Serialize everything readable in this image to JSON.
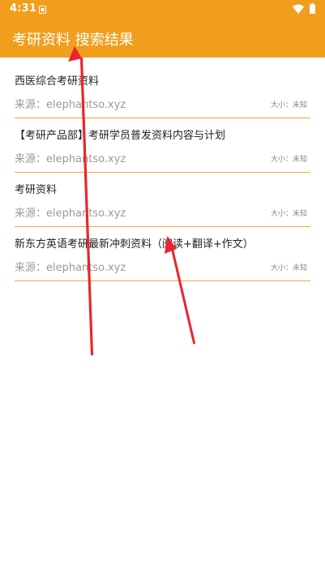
{
  "status_bar": {
    "time": "4:31",
    "icons": [
      "sim-card-icon",
      "wifi-icon",
      "battery-icon"
    ]
  },
  "header": {
    "title": "考研资料 搜索结果"
  },
  "results": [
    {
      "title": "西医综合考研资料",
      "source": "来源：elephantso.xyz",
      "size": "大小：未知"
    },
    {
      "title": "【考研产品部】考研学员普发资料内容与计划",
      "source": "来源：elephantso.xyz",
      "size": "大小：未知"
    },
    {
      "title": "考研资料",
      "source": "来源：elephantso.xyz",
      "size": "大小：未知"
    },
    {
      "title": "新东方英语考研最新冲刺资料（阅读+翻译+作文）",
      "source": "来源：elephantso.xyz",
      "size": "大小：未知"
    }
  ],
  "colors": {
    "header_background": "#f19e1e",
    "divider": "#f2a53a",
    "annotation_arrow": "#e8262d"
  }
}
